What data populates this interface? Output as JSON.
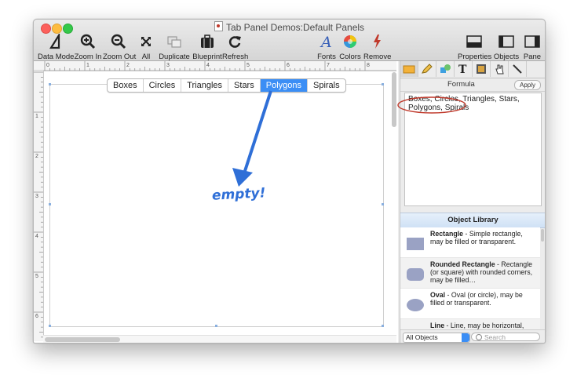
{
  "window": {
    "title": "Tab Panel Demos:Default Panels"
  },
  "toolbar": {
    "left": [
      {
        "label": "Data Mode",
        "icon": "data-mode-icon"
      },
      {
        "label": "Zoom In",
        "icon": "zoom-in-icon"
      },
      {
        "label": "Zoom Out",
        "icon": "zoom-out-icon"
      },
      {
        "label": "All",
        "icon": "expand-icon"
      },
      {
        "label": "Duplicate",
        "icon": "duplicate-icon"
      },
      {
        "label": "Blueprint",
        "icon": "blueprint-icon"
      },
      {
        "label": "Refresh",
        "icon": "refresh-icon"
      }
    ],
    "middle": [
      {
        "label": "Fonts",
        "icon": "fonts-icon"
      },
      {
        "label": "Colors",
        "icon": "colors-icon"
      },
      {
        "label": "Remove",
        "icon": "remove-icon"
      }
    ],
    "right": [
      {
        "label": "Properties",
        "icon": "properties-icon"
      },
      {
        "label": "Objects",
        "icon": "objects-icon"
      },
      {
        "label": "Pane",
        "icon": "pane-icon"
      }
    ]
  },
  "ruler": {
    "marks": [
      "0",
      "1",
      "2",
      "3",
      "4",
      "5",
      "6",
      "7",
      "8"
    ],
    "vmarks": [
      "1",
      "2",
      "3",
      "4",
      "5",
      "6"
    ]
  },
  "tabs": [
    {
      "label": "Boxes",
      "active": false
    },
    {
      "label": "Circles",
      "active": false
    },
    {
      "label": "Triangles",
      "active": false
    },
    {
      "label": "Stars",
      "active": false
    },
    {
      "label": "Polygons",
      "active": true
    },
    {
      "label": "Spirals",
      "active": false
    }
  ],
  "annotation": {
    "text": "empty!"
  },
  "inspector": {
    "formula_label": "Formula",
    "apply_label": "Apply",
    "formula_text": "Boxes, Circles, Triangles, Stars, Polygons, Spirals"
  },
  "library": {
    "title": "Object Library",
    "items": [
      {
        "name": "Rectangle",
        "desc": " - Simple rectangle, may be filled or transparent."
      },
      {
        "name": "Rounded Rectangle",
        "desc": " - Rectangle (or square) with rounded corners, may be filled…"
      },
      {
        "name": "Oval",
        "desc": " - Oval (or circle), may be filled or transparent."
      },
      {
        "name": "Line",
        "desc": " - Line, may be horizontal,"
      }
    ],
    "filter_value": "All Objects",
    "search_placeholder": "Search"
  },
  "colors": {
    "accent": "#3b8ef5",
    "annotation": "#2f6fd7",
    "highlight_circle": "#c0392b",
    "close": "#fc605c",
    "minimize": "#fdbc40",
    "maximize": "#34c84a"
  }
}
